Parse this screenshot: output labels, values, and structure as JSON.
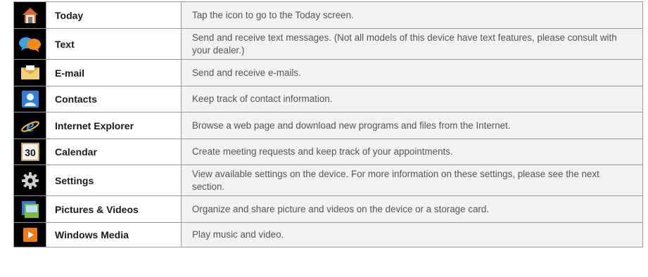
{
  "rows": [
    {
      "icon": "today-house-icon",
      "name": "Today",
      "description": "Tap the icon to go to the Today screen."
    },
    {
      "icon": "text-speech-bubbles-icon",
      "name": "Text",
      "description": "Send and receive text messages. (Not all models of this device have text features, please consult with your dealer.)"
    },
    {
      "icon": "email-envelope-icon",
      "name": "E-mail",
      "description": "Send and receive e-mails."
    },
    {
      "icon": "contacts-person-icon",
      "name": "Contacts",
      "description": "Keep track of contact information."
    },
    {
      "icon": "internet-explorer-icon",
      "name": "Internet Explorer",
      "description": "Browse a web page and download new programs and files from the Internet."
    },
    {
      "icon": "calendar-icon",
      "name": "Calendar",
      "description": "Create meeting requests and keep track of your appointments.",
      "icon_text": "30"
    },
    {
      "icon": "settings-gear-icon",
      "name": "Settings",
      "description": "View available settings on the device. For more information on these settings, please see the next section."
    },
    {
      "icon": "pictures-videos-icon",
      "name": "Pictures & Videos",
      "description": "Organize and share picture and videos on the device or a storage card."
    },
    {
      "icon": "windows-media-icon",
      "name": "Windows Media",
      "description": "Play music and video."
    }
  ]
}
